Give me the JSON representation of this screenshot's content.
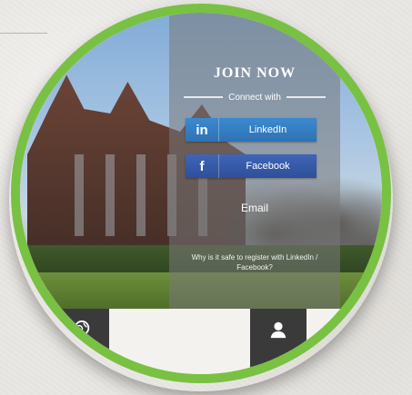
{
  "panel": {
    "title": "JOIN NOW",
    "connect_label": "Connect with",
    "linkedin": {
      "icon_text": "in",
      "label": "LinkedIn",
      "color": "#2f72b3"
    },
    "facebook": {
      "icon_text": "f",
      "label": "Facebook",
      "color": "#2f4f98"
    },
    "email_label": "Email",
    "why_text": "Why is it safe to register with LinkedIn / Facebook?"
  },
  "tabs": [
    {
      "icon": "globe-icon"
    },
    {
      "icon": "user-icon"
    }
  ],
  "colors": {
    "lens_border": "#79c142",
    "tab_bg": "#3a3a3a"
  }
}
